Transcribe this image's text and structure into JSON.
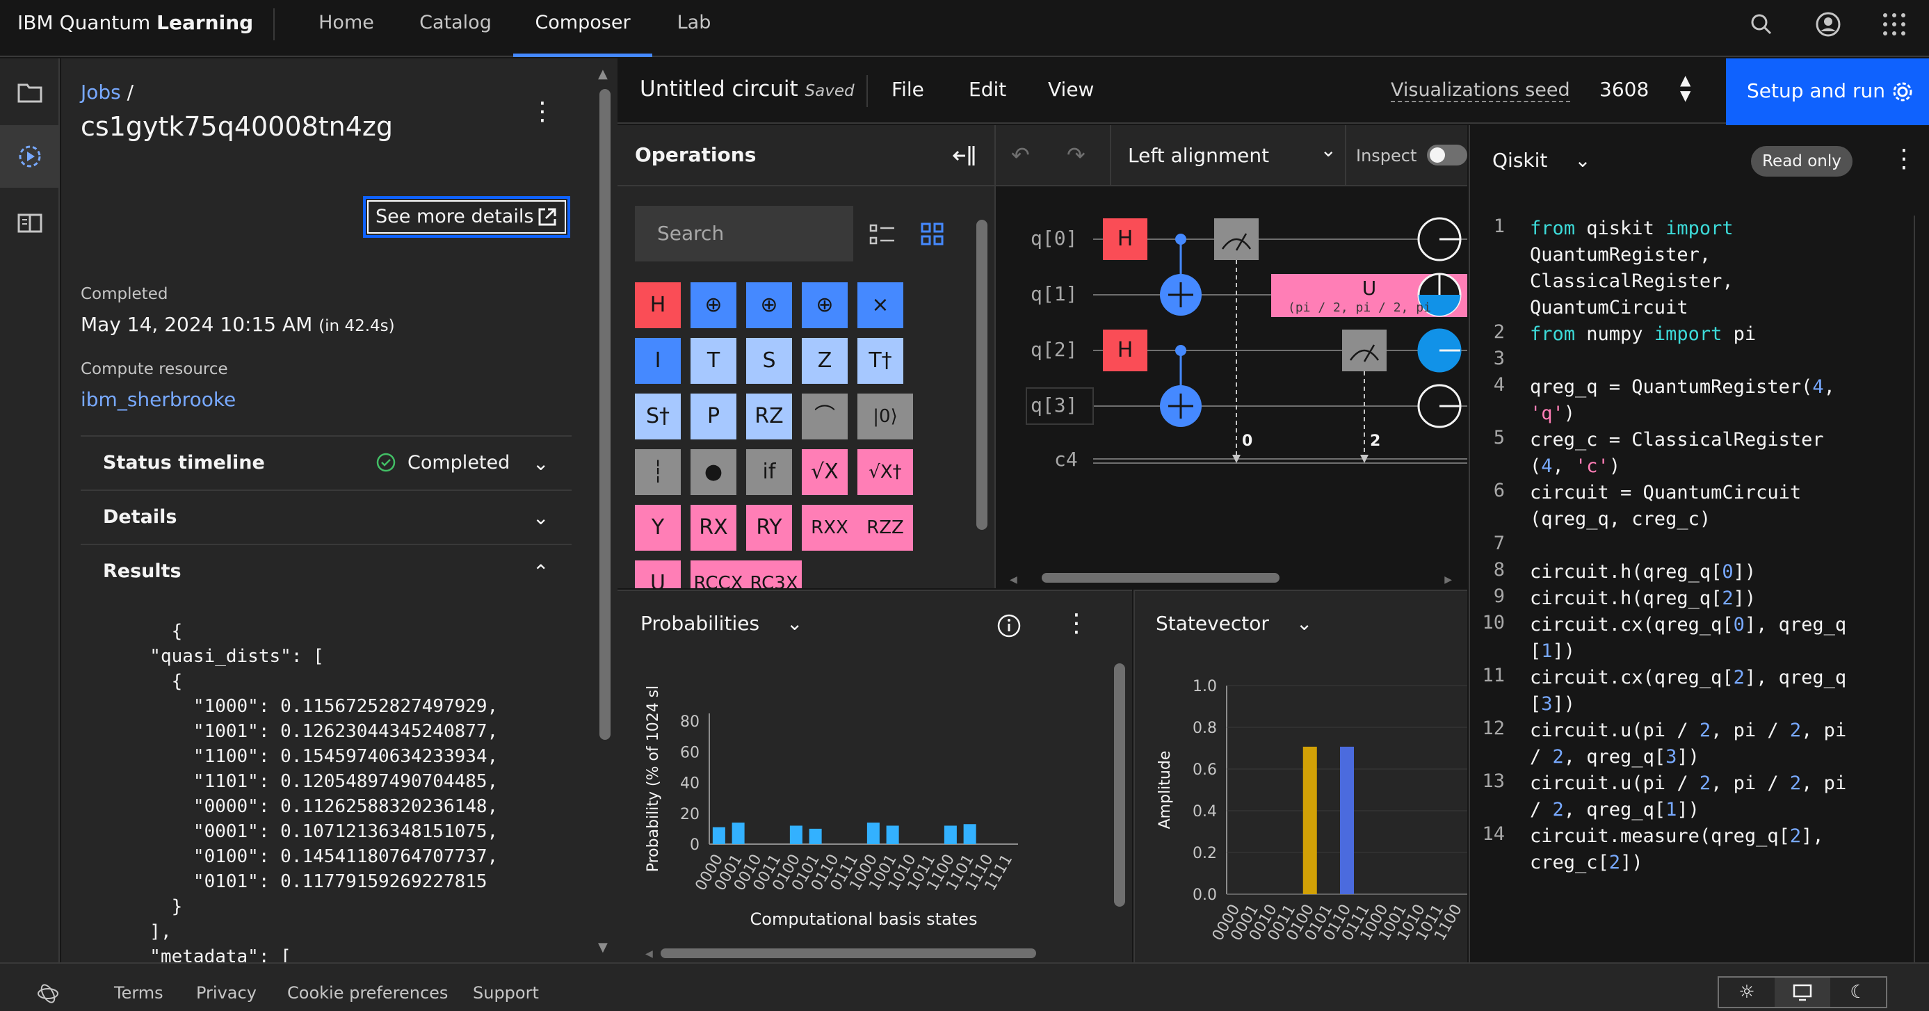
{
  "nav": {
    "brand_prefix": "IBM Quantum",
    "brand_bold": "Learning",
    "items": [
      "Home",
      "Catalog",
      "Composer",
      "Lab"
    ],
    "active": "Composer"
  },
  "job": {
    "breadcrumb": "Jobs",
    "breadcrumb_sep": "/",
    "id": "cs1gytk75q40008tn4zg",
    "see_more": "See more details",
    "completed_label": "Completed",
    "completed_date": "May 14, 2024 10:15 AM",
    "completed_duration": "(in 42.4s)",
    "compute_label": "Compute resource",
    "compute_value": "ibm_sherbrooke",
    "sections": {
      "status": "Status timeline",
      "status_value": "Completed",
      "details": "Details",
      "results": "Results"
    },
    "results_json": "    {\n  \"quasi_dists\": [\n    {\n      \"1000\": 0.11567252827497929,\n      \"1001\": 0.12623044345240877,\n      \"1100\": 0.15459740634233934,\n      \"1101\": 0.12054897490704485,\n      \"0000\": 0.11262588320236148,\n      \"0001\": 0.10712136348151075,\n      \"0100\": 0.14541180764707737,\n      \"0101\": 0.11779159269227815\n    }\n  ],\n  \"metadata\": ["
  },
  "composer": {
    "title": "Untitled circuit",
    "saved": "Saved",
    "menus": [
      "File",
      "Edit",
      "View"
    ],
    "seed_label": "Visualizations seed",
    "seed_value": "3608",
    "setup_run": "Setup and run"
  },
  "operations": {
    "title": "Operations",
    "search_placeholder": "Search",
    "gates": [
      {
        "label": "H",
        "color": "red"
      },
      {
        "label": "⊕",
        "color": "blue"
      },
      {
        "label": "⊕",
        "color": "blue"
      },
      {
        "label": "⊕",
        "color": "blue"
      },
      {
        "label": "×",
        "color": "blue"
      },
      {
        "label": "I",
        "color": "blue"
      },
      {
        "label": "T",
        "color": "lb"
      },
      {
        "label": "S",
        "color": "lb"
      },
      {
        "label": "Z",
        "color": "lb"
      },
      {
        "label": "T†",
        "color": "lb"
      },
      {
        "label": "S†",
        "color": "lb"
      },
      {
        "label": "P",
        "color": "lb"
      },
      {
        "label": "RZ",
        "color": "lb"
      },
      {
        "label": "⌒",
        "color": "gray"
      },
      {
        "label": "|0⟩",
        "color": "gray"
      },
      {
        "label": "┆",
        "color": "gray"
      },
      {
        "label": "●",
        "color": "gray"
      },
      {
        "label": "if",
        "color": "gray"
      },
      {
        "label": "√X",
        "color": "pink"
      },
      {
        "label": "√X†",
        "color": "pink"
      },
      {
        "label": "Y",
        "color": "pink"
      },
      {
        "label": "RX",
        "color": "pink"
      },
      {
        "label": "RY",
        "color": "pink"
      },
      {
        "label": "RXX",
        "color": "pink"
      },
      {
        "label": "RZZ",
        "color": "pink"
      },
      {
        "label": "U",
        "color": "pink"
      },
      {
        "label": "RCCX",
        "color": "pink"
      },
      {
        "label": "RC3X",
        "color": "pink"
      }
    ]
  },
  "canvas": {
    "alignment": "Left alignment",
    "inspect": "Inspect",
    "qubits": [
      "q[0]",
      "q[1]",
      "q[2]",
      "q[3]"
    ],
    "creg": "c4",
    "u_gate_label": "U",
    "u_gate_params": "(pi / 2, pi / 2, pi",
    "h_label": "H",
    "measure_bits": [
      "0",
      "2"
    ]
  },
  "code": {
    "language": "Qiskit",
    "read_only": "Read only",
    "lines": [
      {
        "n": "1",
        "html": "<span class='kw'>from</span> qiskit <span class='kw'>import</span>"
      },
      {
        "n": "",
        "html": "QuantumRegister,"
      },
      {
        "n": "",
        "html": "ClassicalRegister,"
      },
      {
        "n": "",
        "html": "QuantumCircuit"
      },
      {
        "n": "2",
        "html": "<span class='kw'>from</span> numpy <span class='kw'>import</span> pi"
      },
      {
        "n": "3",
        "html": ""
      },
      {
        "n": "4",
        "html": "qreg_q = QuantumRegister(<span class='num'>4</span>,"
      },
      {
        "n": "",
        "html": "<span class='str'>'q'</span>)"
      },
      {
        "n": "5",
        "html": "creg_c = ClassicalRegister"
      },
      {
        "n": "",
        "html": "(<span class='num'>4</span>, <span class='str'>'c'</span>)"
      },
      {
        "n": "6",
        "html": "circuit = QuantumCircuit"
      },
      {
        "n": "",
        "html": "(qreg_q, creg_c)"
      },
      {
        "n": "7",
        "html": ""
      },
      {
        "n": "8",
        "html": "circuit.h(qreg_q[<span class='num'>0</span>])"
      },
      {
        "n": "9",
        "html": "circuit.h(qreg_q[<span class='num'>2</span>])"
      },
      {
        "n": "10",
        "html": "circuit.cx(qreg_q[<span class='num'>0</span>], qreg_q"
      },
      {
        "n": "",
        "html": "[<span class='num'>1</span>])"
      },
      {
        "n": "11",
        "html": "circuit.cx(qreg_q[<span class='num'>2</span>], qreg_q"
      },
      {
        "n": "",
        "html": "[<span class='num'>3</span>])"
      },
      {
        "n": "12",
        "html": "circuit.u(pi / <span class='num'>2</span>, pi / <span class='num'>2</span>, pi"
      },
      {
        "n": "",
        "html": "/ <span class='num'>2</span>, qreg_q[<span class='num'>3</span>])"
      },
      {
        "n": "13",
        "html": "circuit.u(pi / <span class='num'>2</span>, pi / <span class='num'>2</span>, pi"
      },
      {
        "n": "",
        "html": "/ <span class='num'>2</span>, qreg_q[<span class='num'>1</span>])"
      },
      {
        "n": "14",
        "html": "circuit.measure(qreg_q[<span class='num'>2</span>],"
      },
      {
        "n": "",
        "html": "creg_c[<span class='num'>2</span>])"
      }
    ]
  },
  "probabilities": {
    "title": "Probabilities",
    "ylabel": "Probability (% of 1024 sl",
    "xlabel": "Computational basis states"
  },
  "statevector": {
    "title": "Statevector",
    "ylabel": "Amplitude"
  },
  "chart_data": [
    {
      "type": "bar",
      "title": "Probabilities",
      "xlabel": "Computational basis states",
      "ylabel": "Probability (% of 1024 sl",
      "ylim": [
        0,
        85
      ],
      "yticks": [
        0,
        20,
        40,
        60,
        80
      ],
      "categories": [
        "0000",
        "0001",
        "0010",
        "0011",
        "0100",
        "0101",
        "0110",
        "0111",
        "1000",
        "1001",
        "1010",
        "1011",
        "1100",
        "1101",
        "1110",
        "1111"
      ],
      "values": [
        11,
        14,
        0,
        0,
        12,
        10,
        0,
        0,
        14,
        12,
        0,
        0,
        12,
        13,
        0,
        0
      ],
      "color": "#33b1ff"
    },
    {
      "type": "bar",
      "title": "Statevector",
      "ylabel": "Amplitude",
      "ylim": [
        0,
        1.0
      ],
      "yticks": [
        0.0,
        0.2,
        0.4,
        0.6,
        0.8,
        1.0
      ],
      "categories": [
        "0000",
        "0001",
        "0010",
        "0011",
        "0100",
        "0101",
        "0110",
        "0111",
        "1000",
        "1001",
        "1010",
        "1011",
        "1100"
      ],
      "values": [
        0,
        0,
        0,
        0,
        0.707,
        0,
        0.707,
        0,
        0,
        0,
        0,
        0,
        0
      ],
      "colors": [
        "#d2a106",
        "#4b6bde"
      ]
    }
  ],
  "footer": {
    "links": [
      "Terms",
      "Privacy",
      "Cookie preferences",
      "Support"
    ]
  }
}
